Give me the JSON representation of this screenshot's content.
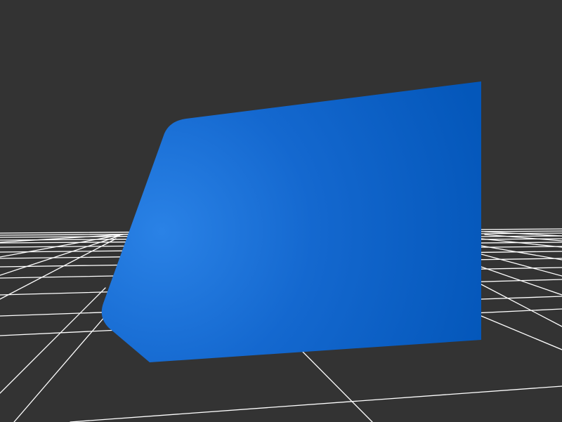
{
  "viewport": {
    "background_color": "#333333",
    "grid_color": "#ffffff"
  },
  "object": {
    "shape": "chamfered-block",
    "color_light": "#2a82e6",
    "color_mid": "#1468cf",
    "color_dark": "#0457ba"
  }
}
